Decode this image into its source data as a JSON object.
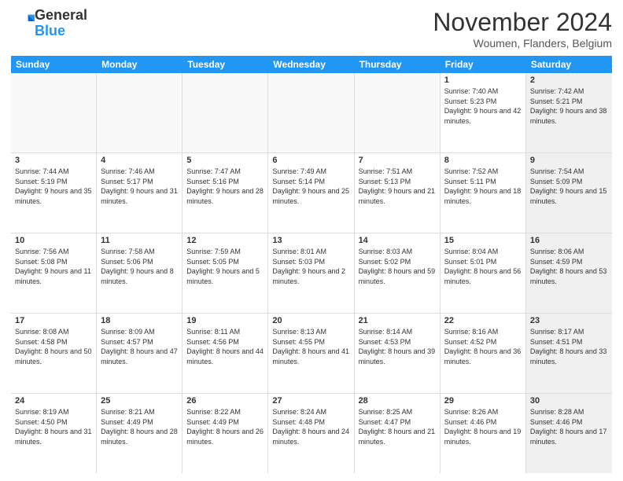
{
  "header": {
    "logo_line1": "General",
    "logo_line2": "Blue",
    "month": "November 2024",
    "location": "Woumen, Flanders, Belgium"
  },
  "weekdays": [
    "Sunday",
    "Monday",
    "Tuesday",
    "Wednesday",
    "Thursday",
    "Friday",
    "Saturday"
  ],
  "rows": [
    {
      "cells": [
        {
          "day": "",
          "info": "",
          "shaded": false
        },
        {
          "day": "",
          "info": "",
          "shaded": false
        },
        {
          "day": "",
          "info": "",
          "shaded": false
        },
        {
          "day": "",
          "info": "",
          "shaded": false
        },
        {
          "day": "",
          "info": "",
          "shaded": false
        },
        {
          "day": "1",
          "info": "Sunrise: 7:40 AM\nSunset: 5:23 PM\nDaylight: 9 hours and 42 minutes.",
          "shaded": false
        },
        {
          "day": "2",
          "info": "Sunrise: 7:42 AM\nSunset: 5:21 PM\nDaylight: 9 hours and 38 minutes.",
          "shaded": true
        }
      ]
    },
    {
      "cells": [
        {
          "day": "3",
          "info": "Sunrise: 7:44 AM\nSunset: 5:19 PM\nDaylight: 9 hours and 35 minutes.",
          "shaded": false
        },
        {
          "day": "4",
          "info": "Sunrise: 7:46 AM\nSunset: 5:17 PM\nDaylight: 9 hours and 31 minutes.",
          "shaded": false
        },
        {
          "day": "5",
          "info": "Sunrise: 7:47 AM\nSunset: 5:16 PM\nDaylight: 9 hours and 28 minutes.",
          "shaded": false
        },
        {
          "day": "6",
          "info": "Sunrise: 7:49 AM\nSunset: 5:14 PM\nDaylight: 9 hours and 25 minutes.",
          "shaded": false
        },
        {
          "day": "7",
          "info": "Sunrise: 7:51 AM\nSunset: 5:13 PM\nDaylight: 9 hours and 21 minutes.",
          "shaded": false
        },
        {
          "day": "8",
          "info": "Sunrise: 7:52 AM\nSunset: 5:11 PM\nDaylight: 9 hours and 18 minutes.",
          "shaded": false
        },
        {
          "day": "9",
          "info": "Sunrise: 7:54 AM\nSunset: 5:09 PM\nDaylight: 9 hours and 15 minutes.",
          "shaded": true
        }
      ]
    },
    {
      "cells": [
        {
          "day": "10",
          "info": "Sunrise: 7:56 AM\nSunset: 5:08 PM\nDaylight: 9 hours and 11 minutes.",
          "shaded": false
        },
        {
          "day": "11",
          "info": "Sunrise: 7:58 AM\nSunset: 5:06 PM\nDaylight: 9 hours and 8 minutes.",
          "shaded": false
        },
        {
          "day": "12",
          "info": "Sunrise: 7:59 AM\nSunset: 5:05 PM\nDaylight: 9 hours and 5 minutes.",
          "shaded": false
        },
        {
          "day": "13",
          "info": "Sunrise: 8:01 AM\nSunset: 5:03 PM\nDaylight: 9 hours and 2 minutes.",
          "shaded": false
        },
        {
          "day": "14",
          "info": "Sunrise: 8:03 AM\nSunset: 5:02 PM\nDaylight: 8 hours and 59 minutes.",
          "shaded": false
        },
        {
          "day": "15",
          "info": "Sunrise: 8:04 AM\nSunset: 5:01 PM\nDaylight: 8 hours and 56 minutes.",
          "shaded": false
        },
        {
          "day": "16",
          "info": "Sunrise: 8:06 AM\nSunset: 4:59 PM\nDaylight: 8 hours and 53 minutes.",
          "shaded": true
        }
      ]
    },
    {
      "cells": [
        {
          "day": "17",
          "info": "Sunrise: 8:08 AM\nSunset: 4:58 PM\nDaylight: 8 hours and 50 minutes.",
          "shaded": false
        },
        {
          "day": "18",
          "info": "Sunrise: 8:09 AM\nSunset: 4:57 PM\nDaylight: 8 hours and 47 minutes.",
          "shaded": false
        },
        {
          "day": "19",
          "info": "Sunrise: 8:11 AM\nSunset: 4:56 PM\nDaylight: 8 hours and 44 minutes.",
          "shaded": false
        },
        {
          "day": "20",
          "info": "Sunrise: 8:13 AM\nSunset: 4:55 PM\nDaylight: 8 hours and 41 minutes.",
          "shaded": false
        },
        {
          "day": "21",
          "info": "Sunrise: 8:14 AM\nSunset: 4:53 PM\nDaylight: 8 hours and 39 minutes.",
          "shaded": false
        },
        {
          "day": "22",
          "info": "Sunrise: 8:16 AM\nSunset: 4:52 PM\nDaylight: 8 hours and 36 minutes.",
          "shaded": false
        },
        {
          "day": "23",
          "info": "Sunrise: 8:17 AM\nSunset: 4:51 PM\nDaylight: 8 hours and 33 minutes.",
          "shaded": true
        }
      ]
    },
    {
      "cells": [
        {
          "day": "24",
          "info": "Sunrise: 8:19 AM\nSunset: 4:50 PM\nDaylight: 8 hours and 31 minutes.",
          "shaded": false
        },
        {
          "day": "25",
          "info": "Sunrise: 8:21 AM\nSunset: 4:49 PM\nDaylight: 8 hours and 28 minutes.",
          "shaded": false
        },
        {
          "day": "26",
          "info": "Sunrise: 8:22 AM\nSunset: 4:49 PM\nDaylight: 8 hours and 26 minutes.",
          "shaded": false
        },
        {
          "day": "27",
          "info": "Sunrise: 8:24 AM\nSunset: 4:48 PM\nDaylight: 8 hours and 24 minutes.",
          "shaded": false
        },
        {
          "day": "28",
          "info": "Sunrise: 8:25 AM\nSunset: 4:47 PM\nDaylight: 8 hours and 21 minutes.",
          "shaded": false
        },
        {
          "day": "29",
          "info": "Sunrise: 8:26 AM\nSunset: 4:46 PM\nDaylight: 8 hours and 19 minutes.",
          "shaded": false
        },
        {
          "day": "30",
          "info": "Sunrise: 8:28 AM\nSunset: 4:46 PM\nDaylight: 8 hours and 17 minutes.",
          "shaded": true
        }
      ]
    }
  ]
}
